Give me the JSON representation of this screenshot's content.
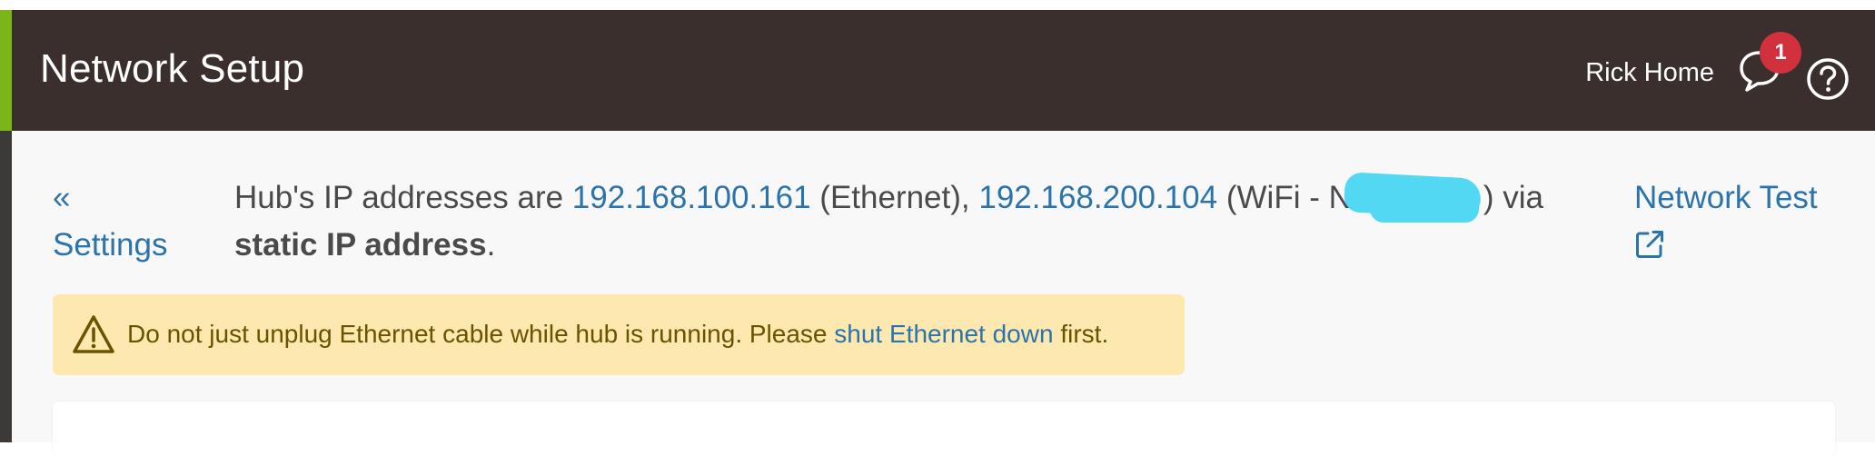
{
  "header": {
    "title": "Network Setup",
    "user": "Rick Home",
    "notification_count": "1",
    "accent_color": "#7cb518",
    "bg_color": "#3a2f2d",
    "icons": [
      "chat-bubble-icon",
      "help-circle-icon"
    ]
  },
  "nav": {
    "back_chevron": "«",
    "back_label": "Settings"
  },
  "ip_info": {
    "prefix": "Hub's IP addresses are ",
    "ethernet_ip": "192.168.100.161",
    "ethernet_suffix": " (Ethernet), ",
    "wifi_ip": "192.168.200.104",
    "wifi_prefix": " (WiFi - N",
    "wifi_suffix": ") via ",
    "method": "static IP address",
    "period": "."
  },
  "network_test": {
    "label": "Network Test",
    "icon": "external-link-icon"
  },
  "alert": {
    "icon": "warning-icon",
    "text_before": "Do not just unplug Ethernet cable while hub is running. Please ",
    "link": "shut Ethernet down",
    "text_after": " first.",
    "bg_color": "#fde9b0"
  }
}
